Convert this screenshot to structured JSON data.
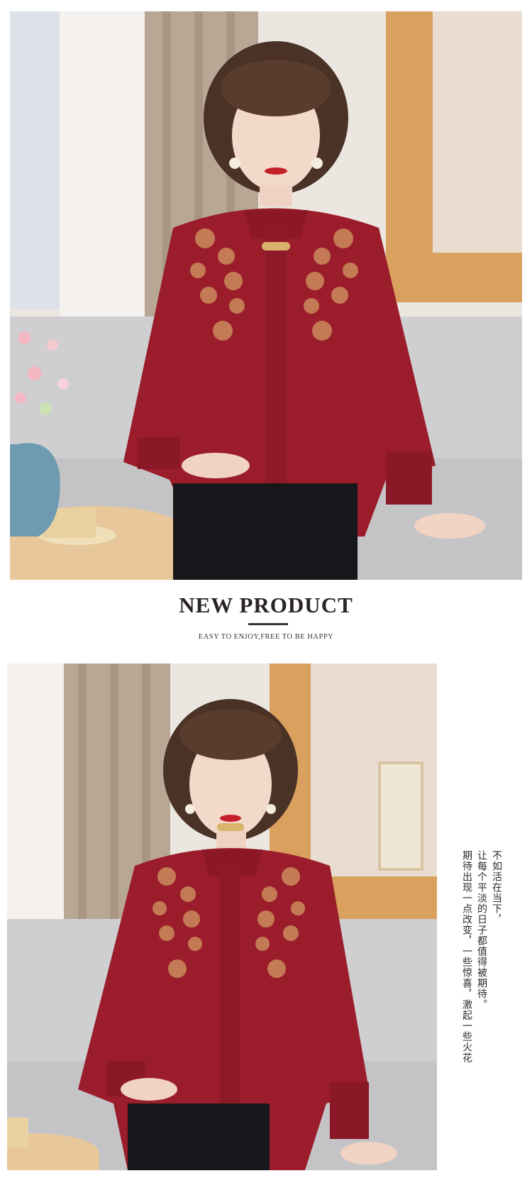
{
  "banner": {
    "headline": "NEW PRODUCT",
    "subline": "EASY TO ENJOY,FREE TO BE HAPPY"
  },
  "poem": {
    "lines": [
      "不如活在当下，",
      "让每个平淡的日子都值得被期待。",
      "期待出现一点改变，一些惊喜，激起一些火花"
    ]
  },
  "colors": {
    "garment": "#9b1d2c",
    "embroidery": "#c9855a",
    "sofa": "#cfcfd2",
    "floor": "#f6f0ea",
    "text_dark": "#2b2424"
  }
}
